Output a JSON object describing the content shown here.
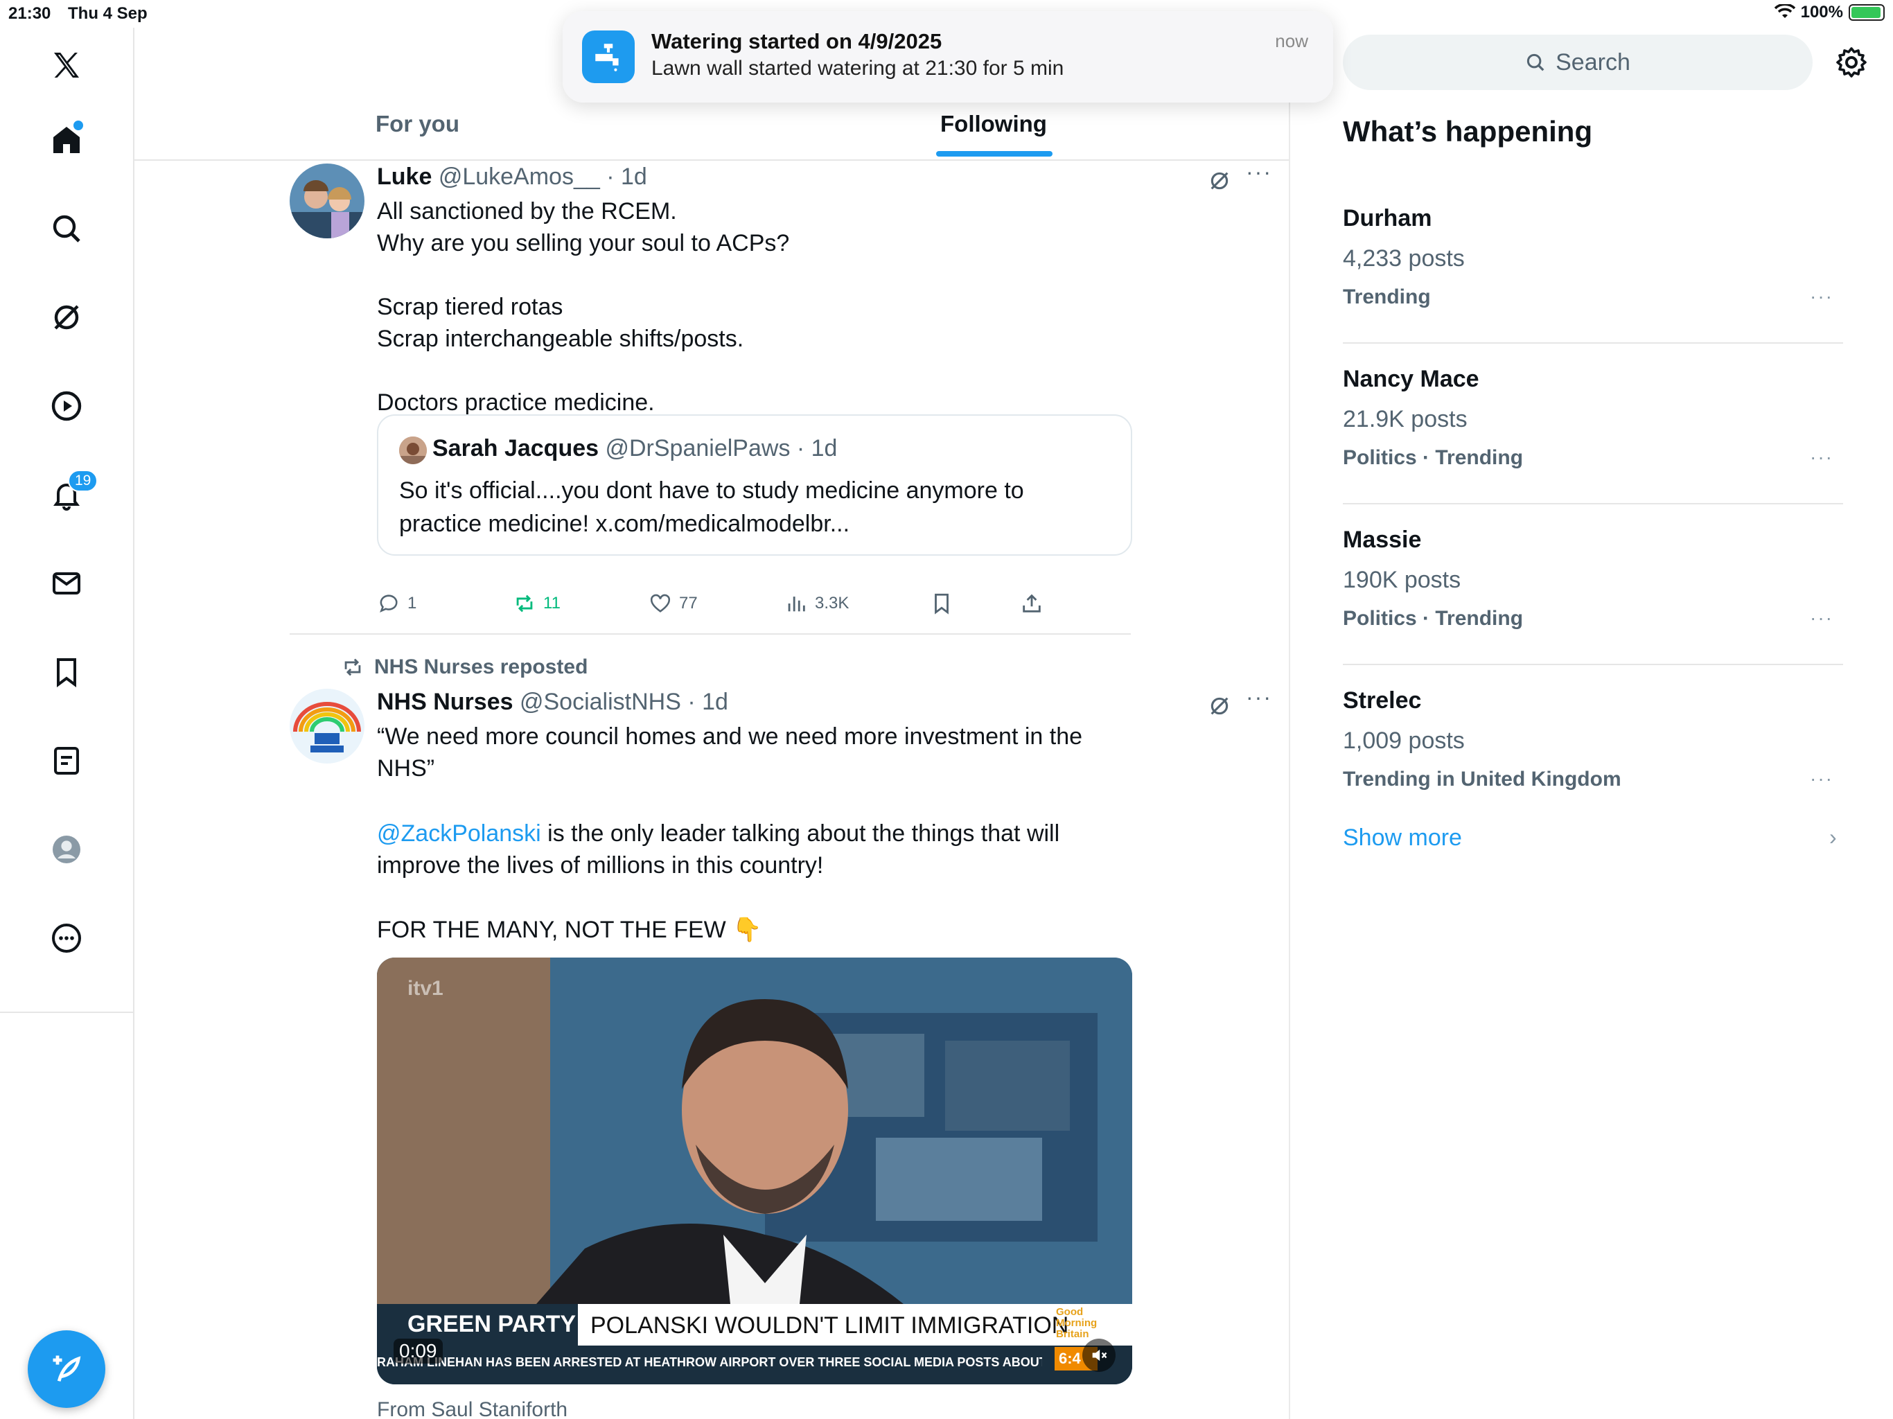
{
  "status_bar": {
    "time": "21:30",
    "date": "Thu 4 Sep",
    "battery": "100%"
  },
  "nav": {
    "items": [
      "home",
      "explore",
      "grok",
      "videos",
      "notifications",
      "messages",
      "bookmarks",
      "lists",
      "profile",
      "more"
    ],
    "notifications_badge": "19"
  },
  "notification": {
    "title": "Watering started on 4/9/2025",
    "body": "Lawn wall started watering at 21:30 for 5 min",
    "time": "now"
  },
  "tabs": {
    "for_you": "For you",
    "following": "Following"
  },
  "tweets": [
    {
      "name": "Luke",
      "meta": "@LukeAmos__ · 1d",
      "text": "All sanctioned by the RCEM.\nWhy are you selling your soul to ACPs?\n\nScrap tiered rotas\nScrap interchangeable shifts/posts.\n\nDoctors practice medicine.",
      "quote": {
        "name": "Sarah Jacques",
        "meta": "@DrSpanielPaws · 1d",
        "text": "So it's official....you dont have to study medicine anymore to practice medicine! x.com/medicalmodelbr..."
      },
      "replies": "1",
      "reposts": "11",
      "likes": "77",
      "views": "3.3K"
    },
    {
      "repost_by": "NHS Nurses reposted",
      "name": "NHS Nurses",
      "meta": "@SocialistNHS · 1d",
      "text_1": "“We need more council homes and we need more investment in the NHS”",
      "mention": "@ZackPolanski",
      "text_2": " is the only leader talking about the things that will improve the lives of millions in this country!",
      "text_3": "FOR THE MANY, NOT THE FEW 👇",
      "video": {
        "channel": "itv1",
        "party": "GREEN PARTY",
        "headline": "POLANSKI WOULDN'T LIMIT IMMIGRATION",
        "ticker": "RAHAM LINEHAN HAS BEEN ARRESTED AT HEATHROW AIRPORT OVER THREE SOCIAL MEDIA POSTS ABOUT TR",
        "show": "Good Morning Britain",
        "clock": "6:4",
        "duration": "0:09"
      },
      "from": "From Saul Staniforth"
    }
  ],
  "right": {
    "search_placeholder": "Search",
    "title": "What’s happening",
    "trends": [
      {
        "name": "Durham",
        "count": "4,233 posts",
        "category": "Trending"
      },
      {
        "name": "Nancy Mace",
        "count": "21.9K posts",
        "category": "Politics · Trending"
      },
      {
        "name": "Massie",
        "count": "190K posts",
        "category": "Politics · Trending"
      },
      {
        "name": "Strelec",
        "count": "1,009 posts",
        "category": "Trending in United Kingdom"
      }
    ],
    "show_more": "Show more"
  },
  "colors": {
    "accent": "#1d9bf0",
    "repost_green": "#00ba7c",
    "muted": "#536471"
  }
}
